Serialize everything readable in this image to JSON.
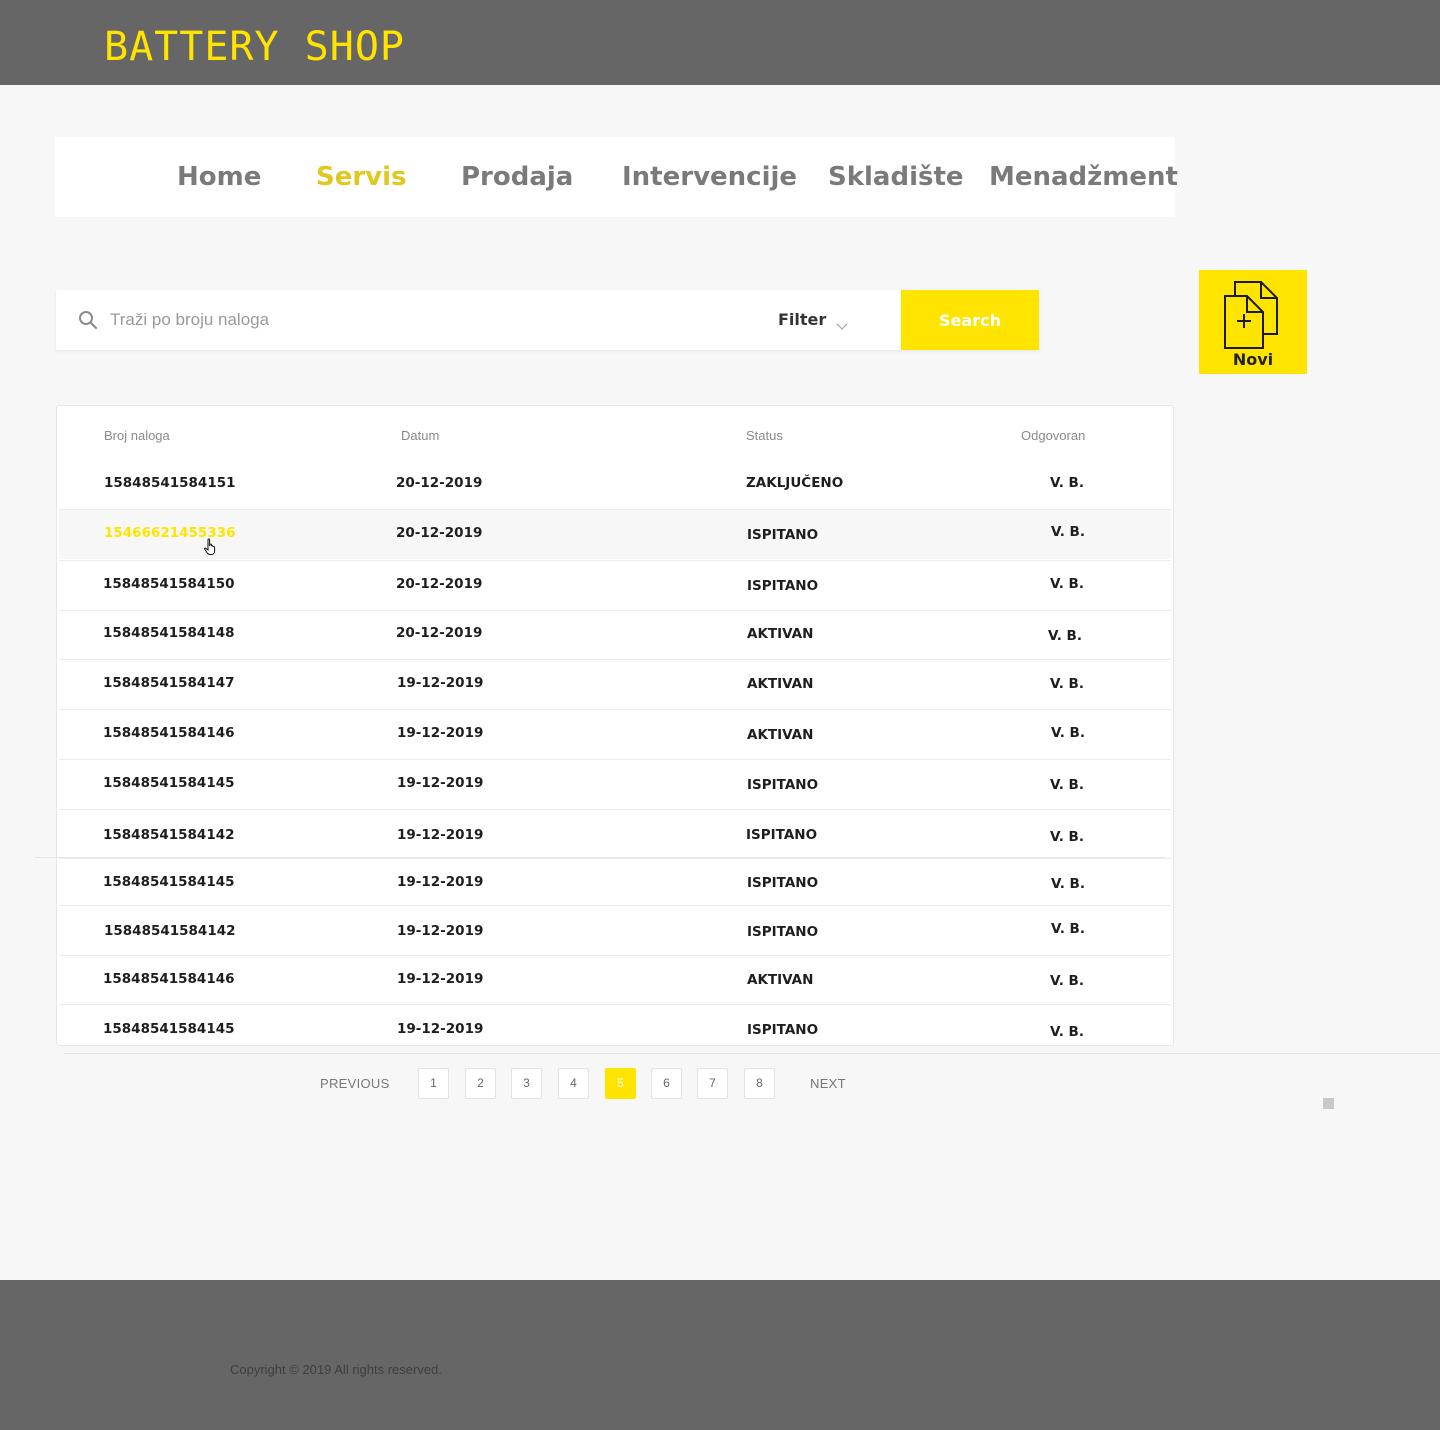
{
  "header": {
    "brand": "BATTERY SHOP"
  },
  "nav": {
    "items": [
      {
        "label": "Home",
        "active": false
      },
      {
        "label": "Servis",
        "active": true
      },
      {
        "label": "Prodaja",
        "active": false
      },
      {
        "label": "Intervencije",
        "active": false
      },
      {
        "label": "Skladište",
        "active": false
      },
      {
        "label": "Menadžment",
        "active": false
      }
    ]
  },
  "search": {
    "placeholder": "Traži po broju naloga",
    "value": "",
    "filter_label": "Filter",
    "button_label": "Search",
    "icon": "search-icon"
  },
  "new_button": {
    "label": "Novi",
    "icon": "new-document-icon"
  },
  "table": {
    "headers": [
      "Broj naloga",
      "Datum",
      "Status",
      "Odgovoran"
    ],
    "rows": [
      [
        "15848541584151",
        "20-12-2019",
        "ZAKLJUČENO",
        "V. B."
      ],
      [
        "15466621455336",
        "20-12-2019",
        "ISPITANO",
        "V. B."
      ],
      [
        "15848541584150",
        "20-12-2019",
        "ISPITANO",
        "V. B."
      ],
      [
        "15848541584148",
        "20-12-2019",
        "AKTIVAN",
        "V. B."
      ],
      [
        "15848541584147",
        "19-12-2019",
        "AKTIVAN",
        "V. B."
      ],
      [
        "15848541584146",
        "19-12-2019",
        "AKTIVAN",
        "V. B."
      ],
      [
        "15848541584145",
        "19-12-2019",
        "ISPITANO",
        "V. B."
      ],
      [
        "15848541584142",
        "19-12-2019",
        "ISPITANO",
        "V. B."
      ],
      [
        "15848541584145",
        "19-12-2019",
        "ISPITANO",
        "V. B."
      ],
      [
        "15848541584142",
        "19-12-2019",
        "ISPITANO",
        "V. B."
      ],
      [
        "15848541584146",
        "19-12-2019",
        "AKTIVAN",
        "V. B."
      ],
      [
        "15848541584145",
        "19-12-2019",
        "ISPITANO",
        "V. B."
      ]
    ],
    "hover_row": 1
  },
  "pagination": {
    "previous": "PREVIOUS",
    "next": "NEXT",
    "pages": [
      "1",
      "2",
      "3",
      "4",
      "5",
      "6",
      "7",
      "8"
    ],
    "current": "5"
  },
  "footer": {
    "copyright": "Copyright © 2019 All rights reserved."
  },
  "colors": {
    "accent": "#ffe400",
    "header_bg": "#666666",
    "nav_active": "#e0c820"
  }
}
